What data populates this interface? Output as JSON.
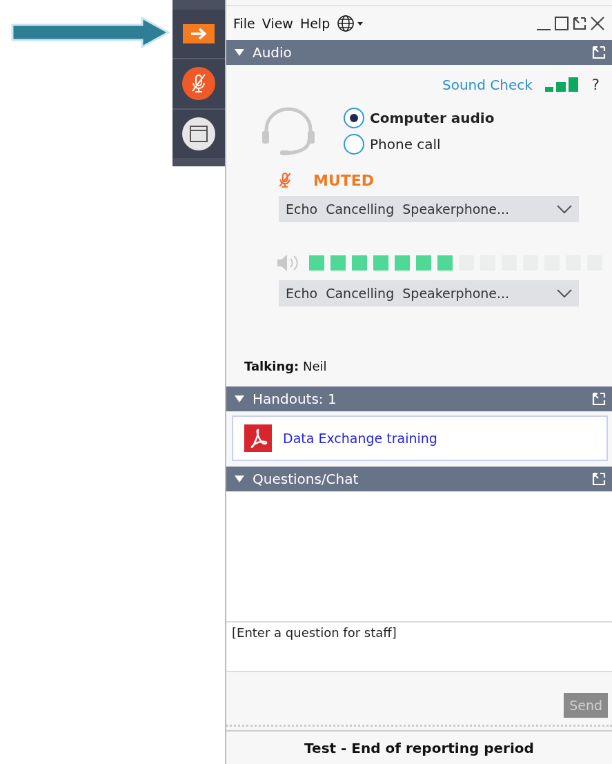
{
  "sidebar": {
    "buttons": [
      {
        "kind": "arrow"
      },
      {
        "kind": "mic",
        "muted": true
      },
      {
        "kind": "window"
      }
    ]
  },
  "menu": [
    "File",
    "View",
    "Help"
  ],
  "audio": {
    "title": "Audio",
    "expanded": true,
    "sound_check": "Sound Check",
    "help": "?",
    "options": [
      {
        "label": "Computer audio",
        "selected": true
      },
      {
        "label": "Phone call",
        "selected": false
      }
    ],
    "muted": true,
    "muted_label": "MUTED",
    "microphone": {
      "value": "Echo  Cancelling  Speakerphone..."
    },
    "speaker": {
      "level": 0.5,
      "value": "Echo  Cancelling  Speakerphone..."
    },
    "talking": "**Talking:** Neil"
  },
  "handouts": {
    "title": "Handouts: 1",
    "expanded": true,
    "items": [
      {
        "label": "Data Exchange training"
      }
    ]
  },
  "chat": {
    "title": "Questions/Chat",
    "expanded": true,
    "placeholder": "[Enter a question for staff]",
    "send": "Send",
    "send_disabled": true
  },
  "footer": "Test - End of reporting period"
}
